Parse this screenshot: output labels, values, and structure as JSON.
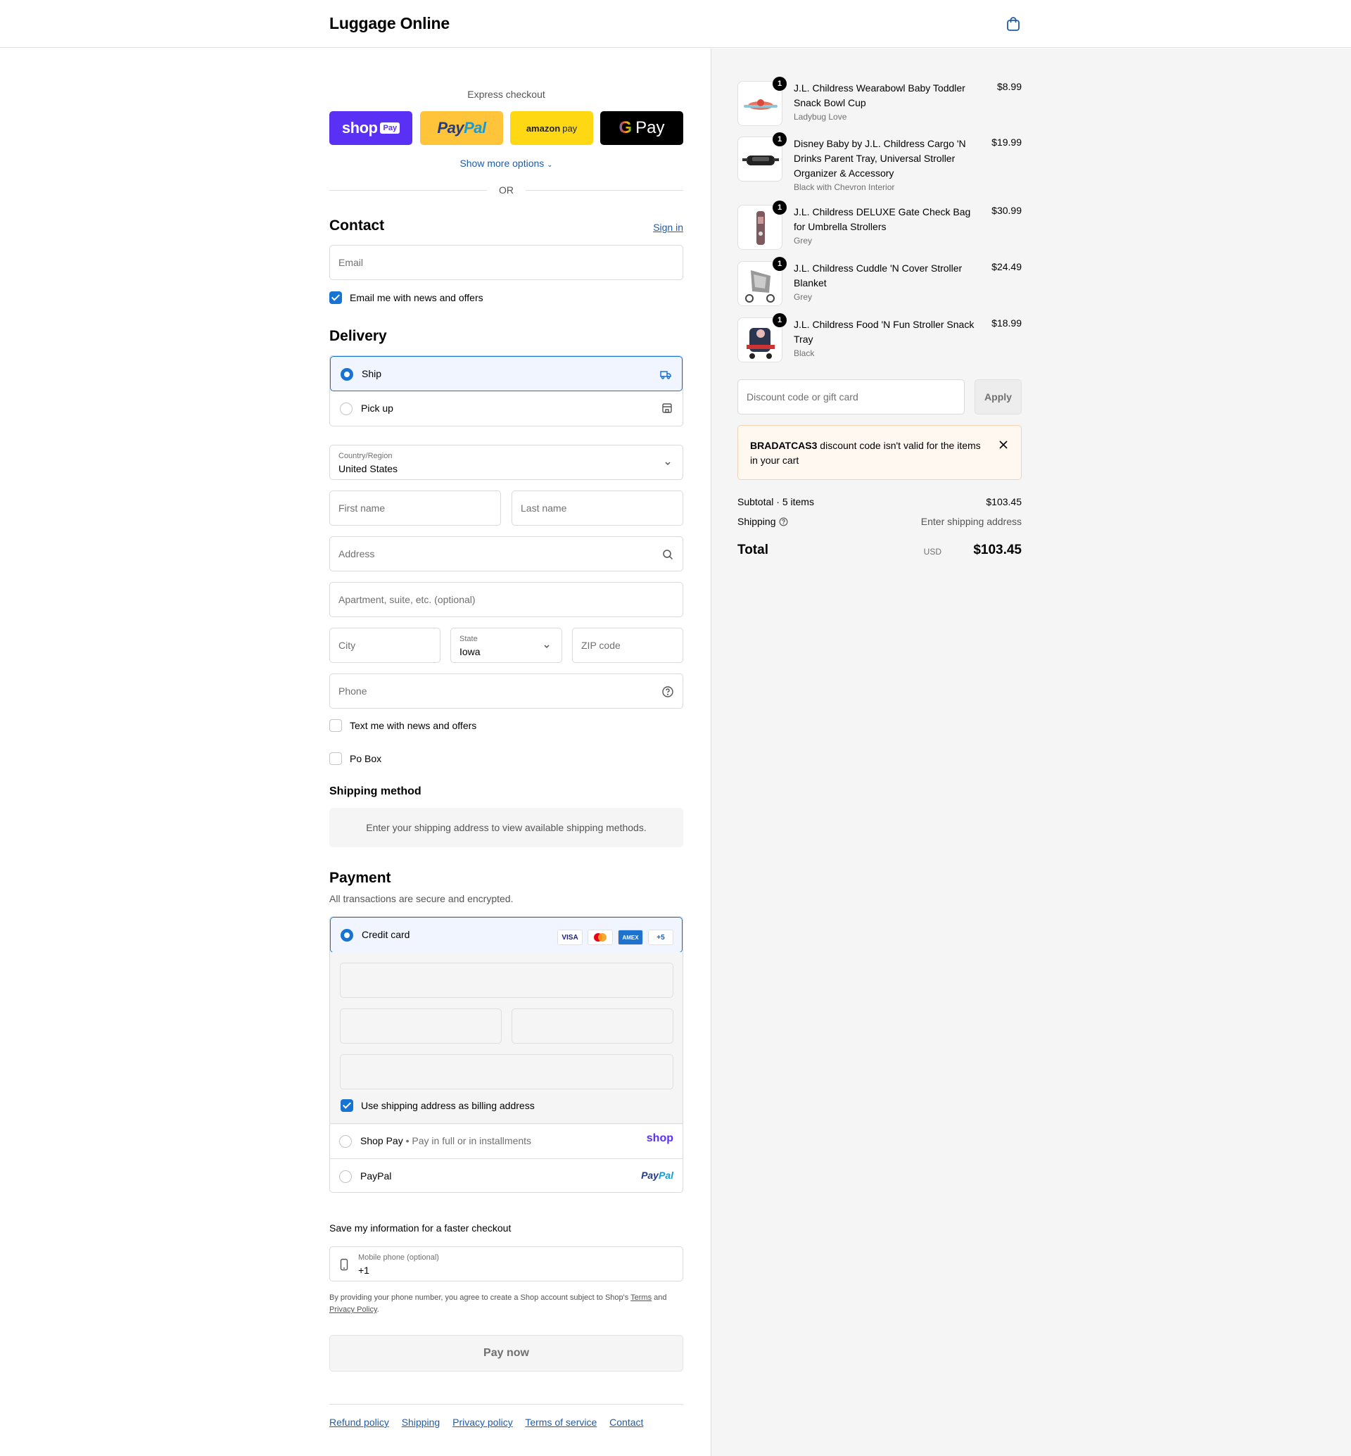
{
  "header": {
    "store_name": "Luggage Online",
    "cart_icon": "shopping-bag-icon"
  },
  "express": {
    "label": "Express checkout",
    "shop_pay": {
      "word": "shop",
      "badge": "Pay"
    },
    "paypal": {
      "part1": "Pay",
      "part2": "Pal"
    },
    "amazon": {
      "word": "amazon",
      "suffix": "pay"
    },
    "gpay": {
      "g": "G",
      "word": "Pay"
    },
    "show_more": "Show more options",
    "or": "OR"
  },
  "contact": {
    "title": "Contact",
    "sign_in": "Sign in",
    "email_placeholder": "Email",
    "newsletter_label": "Email me with news and offers",
    "newsletter_checked": true
  },
  "delivery": {
    "title": "Delivery",
    "options": [
      {
        "label": "Ship",
        "selected": true,
        "icon": "truck-icon"
      },
      {
        "label": "Pick up",
        "selected": false,
        "icon": "store-icon"
      }
    ],
    "country_label": "Country/Region",
    "country_value": "United States",
    "first_name": "First name",
    "last_name": "Last name",
    "address": "Address",
    "apartment": "Apartment, suite, etc. (optional)",
    "city": "City",
    "state_label": "State",
    "state_value": "Iowa",
    "zip": "ZIP code",
    "phone": "Phone",
    "text_me_label": "Text me with news and offers",
    "po_box_label": "Po Box"
  },
  "shipping_method": {
    "title": "Shipping method",
    "note": "Enter your shipping address to view available shipping methods."
  },
  "payment": {
    "title": "Payment",
    "secure_note": "All transactions are secure and encrypted.",
    "credit_card_label": "Credit card",
    "card_badges": [
      "VISA",
      "MC",
      "AMEX",
      "+5"
    ],
    "billing_label": "Use shipping address as billing address",
    "shop_pay_label": "Shop Pay",
    "shop_pay_sub": "Pay in full or in installments",
    "shop_logo": "shop",
    "paypal_label": "PayPal",
    "paypal_logo_1": "Pay",
    "paypal_logo_2": "Pal"
  },
  "save_info": {
    "title": "Save my information for a faster checkout",
    "mobile_label": "Mobile phone (optional)",
    "mobile_value": "+1",
    "legal_1": "By providing your phone number, you agree to create a Shop account subject to Shop's",
    "legal_terms": "Terms",
    "legal_2": "and",
    "legal_privacy": "Privacy Policy",
    "legal_3": "."
  },
  "pay_now": "Pay now",
  "footer": {
    "links": [
      "Refund policy",
      "Shipping",
      "Privacy policy",
      "Terms of service",
      "Contact"
    ]
  },
  "cart": {
    "items": [
      {
        "name": "J.L. Childress Wearabowl Baby Toddler Snack Bowl Cup",
        "variant": "Ladybug Love",
        "price": "$8.99",
        "qty": "1"
      },
      {
        "name": "Disney Baby by J.L. Childress Cargo 'N Drinks Parent Tray, Universal Stroller Organizer & Accessory",
        "variant": "Black with Chevron Interior",
        "price": "$19.99",
        "qty": "1"
      },
      {
        "name": "J.L. Childress DELUXE Gate Check Bag for Umbrella Strollers",
        "variant": "Grey",
        "price": "$30.99",
        "qty": "1"
      },
      {
        "name": "J.L. Childress Cuddle 'N Cover Stroller Blanket",
        "variant": "Grey",
        "price": "$24.49",
        "qty": "1"
      },
      {
        "name": "J.L. Childress Food 'N Fun Stroller Snack Tray",
        "variant": "Black",
        "price": "$18.99",
        "qty": "1"
      }
    ],
    "discount_placeholder": "Discount code or gift card",
    "apply_label": "Apply",
    "alert_code": "BRADATCAS3",
    "alert_text": " discount code isn't valid for the items in your cart",
    "subtotal_label": "Subtotal · 5 items",
    "subtotal_value": "$103.45",
    "shipping_label": "Shipping",
    "shipping_value": "Enter shipping address",
    "total_label": "Total",
    "total_currency": "USD",
    "total_value": "$103.45"
  },
  "colors": {
    "accent": "#1773d4",
    "link": "#1f5ca8",
    "shop_purple": "#5a31f4"
  }
}
